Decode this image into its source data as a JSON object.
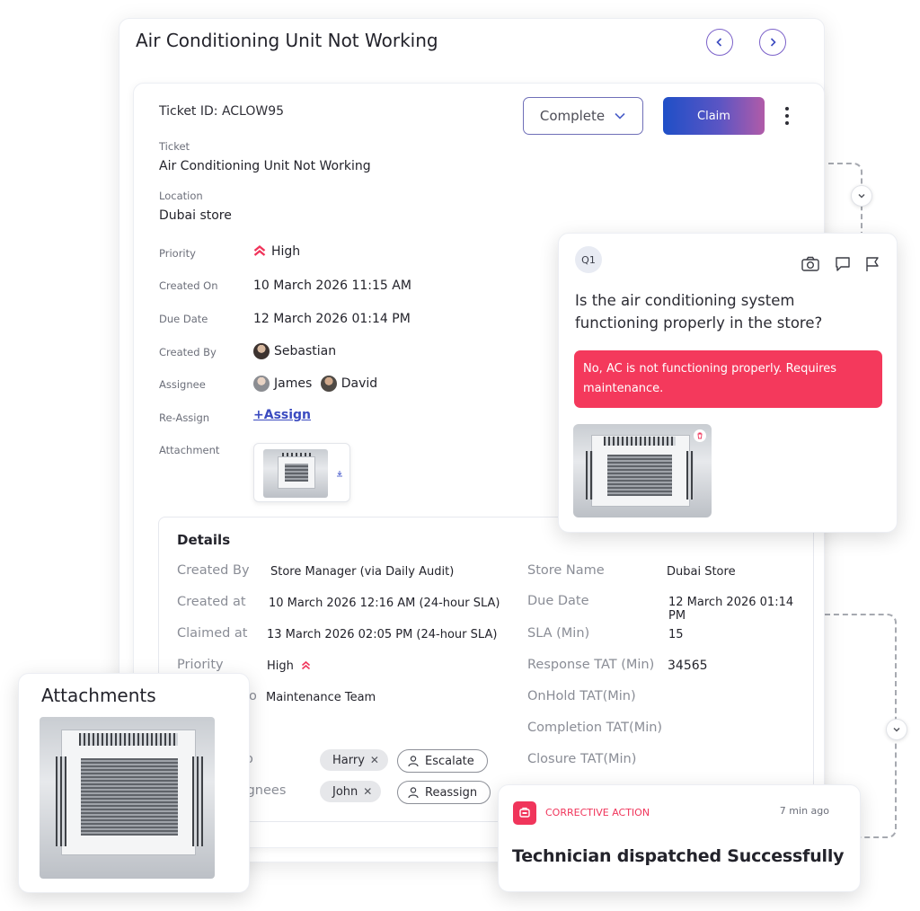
{
  "window": {
    "title": "Air Conditioning Unit Not Working",
    "prev_icon": "chevron-left-icon",
    "next_icon": "chevron-right-icon"
  },
  "ticket": {
    "id_label": "Ticket ID: ACLOW95",
    "status_button": "Complete",
    "claim_button": "Claim",
    "ticket_label": "Ticket",
    "ticket_value": "Air Conditioning Unit Not Working",
    "location_label": "Location",
    "location_value": "Dubai store",
    "fields": {
      "priority_label": "Priority",
      "priority_value": "High",
      "created_on_label": "Created On",
      "created_on_value": "10 March 2026 11:15 AM",
      "due_date_label": "Due Date",
      "due_date_value": "12 March 2026 01:14 PM",
      "created_by_label": "Created By",
      "created_by_value": "Sebastian",
      "assignee_label": "Assignee",
      "assignee_1": "James",
      "assignee_2": "David",
      "reassign_label": "Re-Assign",
      "reassign_link": "+Assign",
      "attachment_label": "Attachment"
    }
  },
  "details": {
    "title": "Details",
    "left": {
      "created_by_k": "Created By",
      "created_by_v": "Store Manager (via Daily Audit)",
      "created_at_k": "Created at",
      "created_at_v": "10 March 2026 12:16 AM (24-hour SLA)",
      "claimed_at_k": "Claimed at",
      "claimed_at_v": "13 March 2026 02:05 PM (24-hour SLA)",
      "priority_k": "Priority",
      "priority_v": "High",
      "assigned_to_k": "o",
      "assigned_to_v": "Maintenance Team",
      "escalate_k": "o",
      "assignees_k": "signees"
    },
    "chips": {
      "harry": "Harry",
      "john": "John",
      "escalate": "Escalate",
      "reassign": "Reassign"
    },
    "right": {
      "store_name_k": "Store Name",
      "store_name_v": "Dubai Store",
      "due_date_k": "Due Date",
      "due_date_v": "12 March 2026 01:14 PM",
      "sla_k": "SLA (Min)",
      "sla_v": "15",
      "response_k": "Response TAT (Min)",
      "response_v": "34565",
      "onhold_k": "OnHold TAT(Min)",
      "completion_k": "Completion TAT(Min)",
      "closure_k": "Closure TAT(Min)"
    }
  },
  "question": {
    "badge": "Q1",
    "text": "Is the air conditioning system functioning properly in the store?",
    "answer": "No, AC is not functioning properly. Requires maintenance.",
    "icons": [
      "camera-icon",
      "comment-icon",
      "flag-icon"
    ]
  },
  "attachments": {
    "title": "Attachments"
  },
  "corrective_action": {
    "label": "CORRECTIVE ACTION",
    "time": "7 min ago",
    "message": "Technician dispatched Successfully"
  },
  "colors": {
    "accent_red": "#f4395c",
    "claim_gradient_start": "#1f4fc7",
    "claim_gradient_end": "#b15ba8",
    "link": "#3b4bc0"
  }
}
